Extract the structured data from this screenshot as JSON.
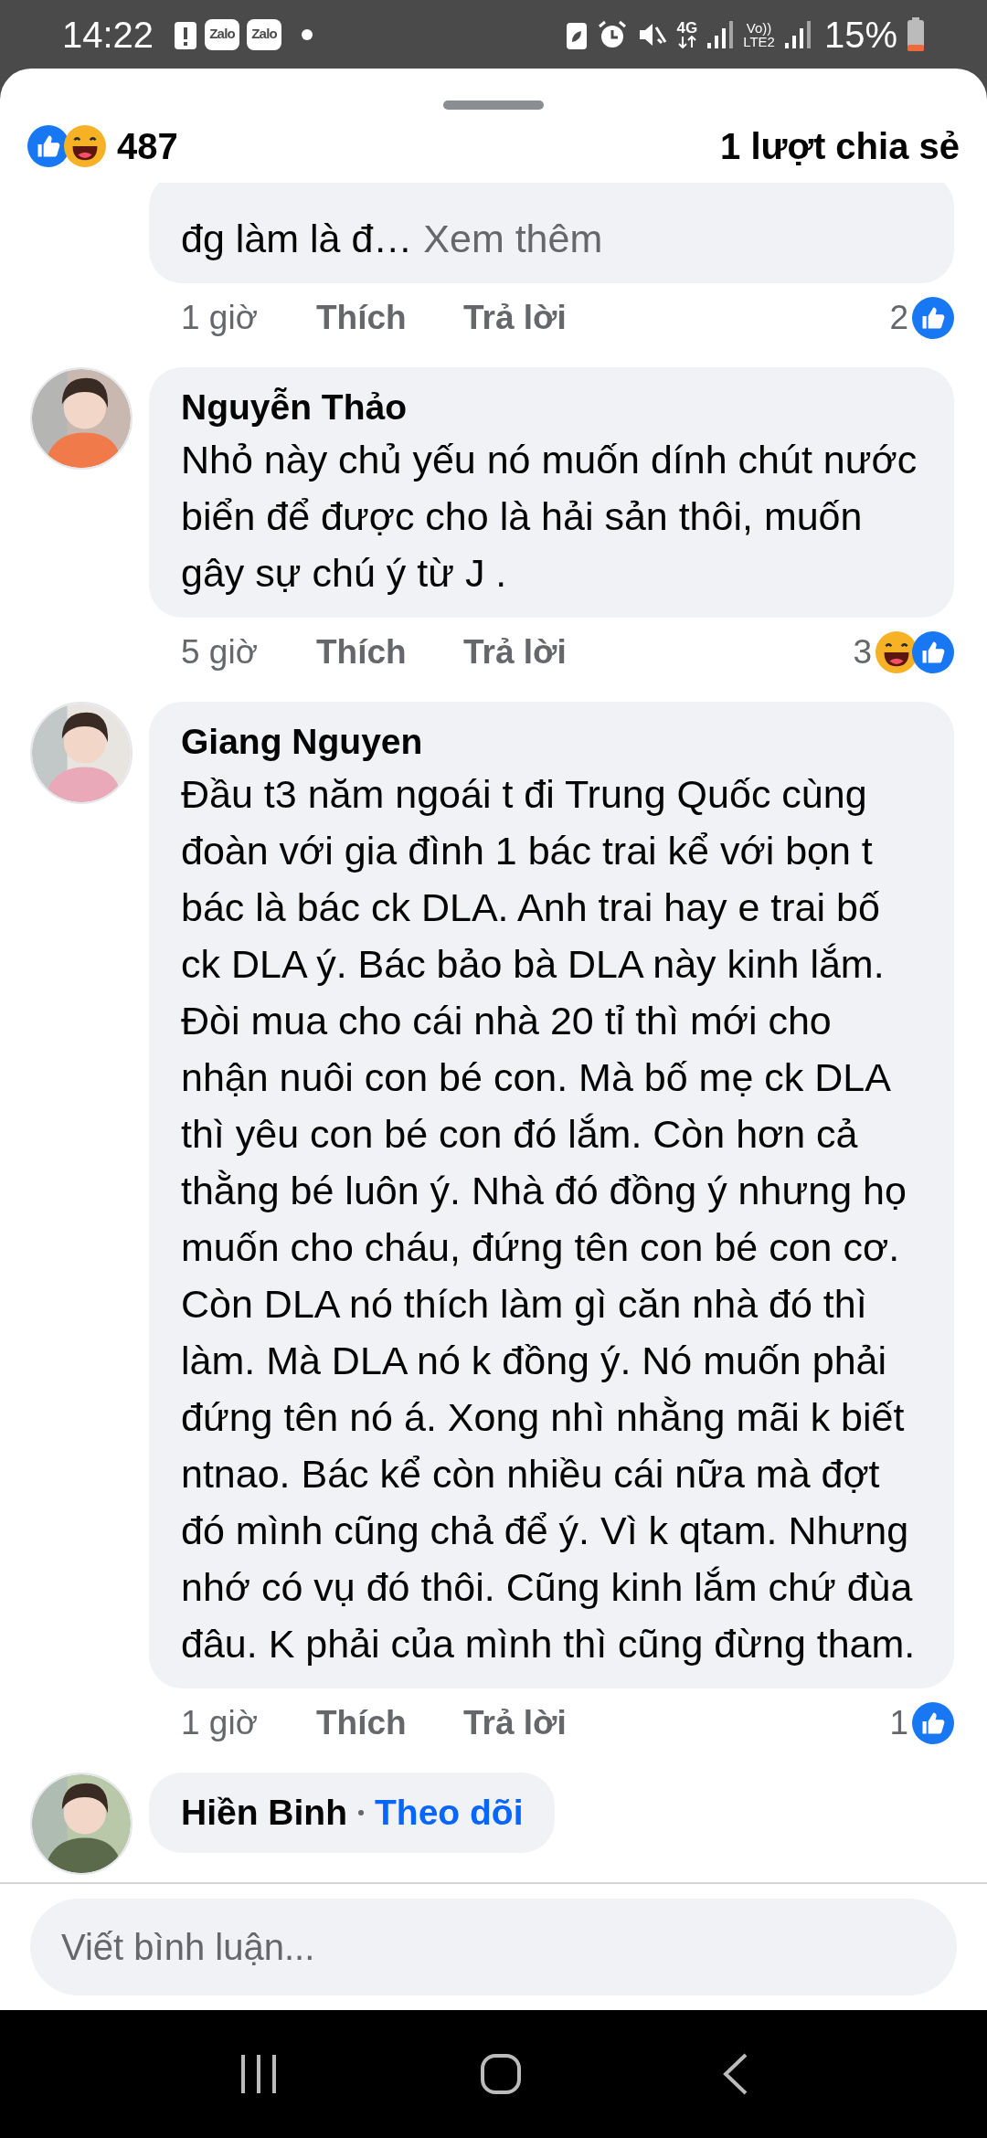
{
  "status_bar": {
    "time": "14:22",
    "notifications": [
      {
        "kind": "alert"
      },
      {
        "kind": "app",
        "label": "Zalo"
      },
      {
        "kind": "app",
        "label": "Zalo"
      },
      {
        "kind": "dot"
      }
    ],
    "network": "4G",
    "sim2": [
      "Vo))",
      "LTE2"
    ],
    "battery": "15%"
  },
  "reactions": {
    "types": [
      {
        "kind": "like"
      },
      {
        "kind": "haha"
      }
    ],
    "count": "487",
    "shares": "1 lượt chia sẻ"
  },
  "comments": [
    {
      "text": "đg làm là đ…",
      "see_more": "Xem thêm",
      "time": "1 giờ",
      "like": "Thích",
      "reply": "Trả lời",
      "reaction_count": "2",
      "reactions": [
        {
          "kind": "like"
        }
      ]
    },
    {
      "author": "Nguyễn Thảo",
      "text": "Nhỏ này chủ yếu nó muốn dính chút nước biển để được cho là hải sản thôi, muốn gây sự chú ý từ J .",
      "time": "5 giờ",
      "like": "Thích",
      "reply": "Trả lời",
      "reaction_count": "3",
      "reactions": [
        {
          "kind": "haha"
        },
        {
          "kind": "like"
        }
      ]
    },
    {
      "author": "Giang Nguyen",
      "text": "Đầu t3 năm ngoái t đi Trung Quốc cùng đoàn với gia đình 1 bác trai kể với bọn t bác là bác ck DLA. Anh trai hay e trai bố ck DLA ý. Bác bảo bà DLA này kinh lắm. Đòi mua cho cái nhà 20 tỉ thì mới cho nhận nuôi con bé con. Mà bố mẹ ck DLA thì yêu con bé con đó lắm. Còn hơn cả thằng bé luôn ý. Nhà đó đồng ý nhưng họ muốn cho cháu, đứng tên con bé con cơ. Còn DLA nó thích làm gì căn nhà đó thì làm. Mà DLA nó k đồng ý. Nó muốn phải đứng tên nó á. Xong nhì nhằng mãi k biết ntnao. Bác kể còn nhiều cái nữa mà đợt đó mình cũng chả để ý. Vì k qtam. Nhưng nhớ có vụ đó thôi. Cũng kinh lắm chứ đùa đâu. K phải của mình thì cũng đừng tham.",
      "time": "1 giờ",
      "like": "Thích",
      "reply": "Trả lời",
      "reaction_count": "1",
      "reactions": [
        {
          "kind": "like"
        }
      ]
    },
    {
      "author": "Hiền Binh",
      "follow": "Theo dõi"
    }
  ],
  "composer": {
    "placeholder": "Viết bình luận..."
  }
}
